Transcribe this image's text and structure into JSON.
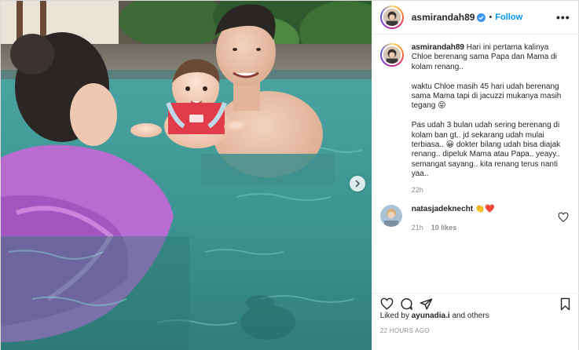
{
  "header": {
    "username": "asmirandah89",
    "dot": "•",
    "follow_label": "Follow",
    "more_label": "•••"
  },
  "caption": {
    "username": "asmirandah89",
    "text": "Hari ini pertama kalinya Chloe berenang sama Papa dan Mama di kolam renang..\n\nwaktu Chloe masih 45 hari udah berenang sama Mama tapi di jacuzzi mukanya masih tegang 😝\n\nPas udah 3 bulan udah sering berenang di kolam ban gt.. jd sekarang udah mulai terbiasa.. 😀 dokter bilang udah bisa diajak renang.. dipeluk Mama atau Papa.. yeayy.. semangat sayang.. kita renang terus nanti yaa..",
    "time": "22h"
  },
  "comment": {
    "username": "natasjadeknecht",
    "text": "👏❤️",
    "time": "21h",
    "likes": "10 likes"
  },
  "likes_line": {
    "prefix": "Liked by",
    "user": "ayunadia.i",
    "suffix": "and others"
  },
  "timestamp": "22 HOURS AGO",
  "colors": {
    "follow": "#0095f6",
    "verified": "#3897f0",
    "muted": "#8e8e8e"
  },
  "icons": [
    "verified-badge-icon",
    "chevron-right-icon",
    "heart-icon",
    "comment-icon",
    "share-icon",
    "bookmark-icon"
  ]
}
